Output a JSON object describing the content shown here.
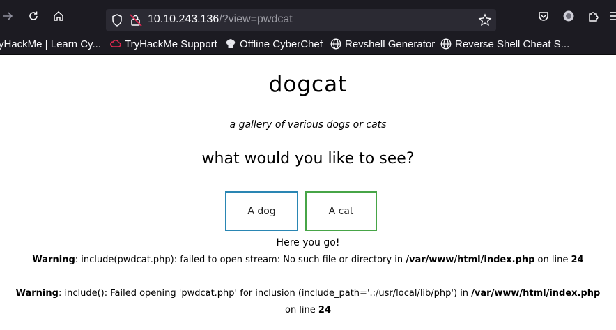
{
  "browser": {
    "url_host": "10.10.243.136",
    "url_path": "/?view=pwdcat",
    "bookmarks": [
      {
        "label": "yHackMe | Learn Cy...",
        "icon": "tryhackme-icon"
      },
      {
        "label": "TryHackMe Support",
        "icon": "cloud-icon"
      },
      {
        "label": "Offline CyberChef",
        "icon": "chef-icon"
      },
      {
        "label": "Revshell Generator",
        "icon": "globe-icon"
      },
      {
        "label": "Reverse Shell Cheat S...",
        "icon": "globe-icon"
      }
    ]
  },
  "page": {
    "title": "dogcat",
    "subtitle": "a gallery of various dogs or cats",
    "question": "what would you like to see?",
    "buttons": {
      "dog": "A dog",
      "cat": "A cat"
    },
    "here": "Here you go!",
    "warning1": {
      "label": "Warning",
      "text": ": include(pwdcat.php): failed to open stream: No such file or directory in ",
      "path": "/var/www/html/index.php",
      "on_line": " on line ",
      "line": "24"
    },
    "warning2": {
      "label": "Warning",
      "text": ": include(): Failed opening 'pwdcat.php' for inclusion (include_path='.:/usr/local/lib/php') in ",
      "path": "/var/www/html/index.php",
      "on_line": "on line ",
      "line": "24"
    }
  }
}
